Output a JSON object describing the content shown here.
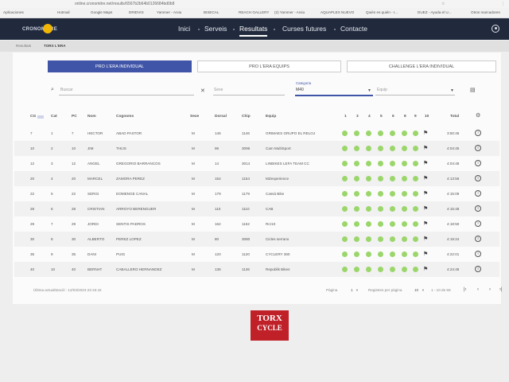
{
  "browser": {
    "url": "online.cronomitre.net/results/6567b2b64b0126684bd0b8",
    "bookmarks": [
      "Aplicaciones",
      "Hotmail",
      "Google Maps",
      "DRIDVIS",
      "Yammer - Arxiu",
      "BISECAL",
      "REACH GALLERY",
      "(2) Yammer - Arxiu",
      "AQUAPLEX NUEVO",
      "Quién es quién - I...",
      "DUEZ - Ayuda el U...",
      "Otros marcadores"
    ]
  },
  "nav": {
    "logo": "CRONOMITRE",
    "links": [
      "Inici",
      "Serveis",
      "Resultats",
      "Curses futures",
      "Contacte"
    ]
  },
  "breadcrumb": {
    "first": "Resultats",
    "second": "TORX L'ERA"
  },
  "tabs": [
    "PRO L'ERA INDIVIDUAL",
    "PRO L'ERA EQUIPS",
    "CHALLENGE L'ERA INDIVIDUAL"
  ],
  "filters": {
    "search_placeholder": "Buscar",
    "sexe_placeholder": "Sexe",
    "categoria_label": "Categoria",
    "categoria_value": "M40",
    "equip_placeholder": "Equip"
  },
  "table": {
    "headers": {
      "cg": "CG",
      "cat": "Cat",
      "pc": "PC",
      "nom": "Nom",
      "cognoms": "Cognoms",
      "sexe": "Sexe",
      "dorsal": "Dorsal",
      "chip": "Chip",
      "equip": "Equip",
      "laps": [
        "1",
        "3",
        "4",
        "5",
        "6",
        "8",
        "9",
        "10"
      ],
      "total": "Total"
    },
    "rows": [
      {
        "cg": "7",
        "cat": "1",
        "pc": "7",
        "nom": "HECTOR",
        "cognoms": "ABAD PASTOR",
        "sexe": "M",
        "dorsal": "146",
        "chip": "1146",
        "equip": "GRIMAES GRUPO EL RELOJ",
        "total": "3:50:46",
        "laps_done": 7,
        "flag": true
      },
      {
        "cg": "10",
        "cat": "2",
        "pc": "10",
        "nom": "JIM",
        "cognoms": "THIJS",
        "sexe": "M",
        "dorsal": "96",
        "chip": "3096",
        "equip": "Cam MultiSport",
        "total": "4:04:45",
        "laps_done": 7,
        "flag": true
      },
      {
        "cg": "12",
        "cat": "3",
        "pc": "12",
        "nom": "ANGEL",
        "cognoms": "GREGORIO BARRANCOS",
        "sexe": "M",
        "dorsal": "14",
        "chip": "3014",
        "equip": "LINBIKES LEFA TEAM CC",
        "total": "4:04:48",
        "laps_done": 7,
        "flag": true
      },
      {
        "cg": "20",
        "cat": "4",
        "pc": "20",
        "nom": "MARCEL",
        "cognoms": "ZAMORA PEREZ",
        "sexe": "M",
        "dorsal": "154",
        "chip": "1154",
        "equip": "MZexperience",
        "total": "4:13:56",
        "laps_done": 7,
        "flag": true
      },
      {
        "cg": "22",
        "cat": "5",
        "pc": "22",
        "nom": "SERGI",
        "cognoms": "DOMENGE CANAL",
        "sexe": "M",
        "dorsal": "179",
        "chip": "1179",
        "equip": "Cassà Bike",
        "total": "4:15:09",
        "laps_done": 7,
        "flag": true
      },
      {
        "cg": "28",
        "cat": "6",
        "pc": "28",
        "nom": "CRISTIAN",
        "cognoms": "ARROYO BERENGUER",
        "sexe": "M",
        "dorsal": "110",
        "chip": "1110",
        "equip": "CAB",
        "total": "4:15:48",
        "laps_done": 7,
        "flag": true
      },
      {
        "cg": "29",
        "cat": "7",
        "pc": "29",
        "nom": "JORDI",
        "cognoms": "SENTIS PADROS",
        "sexe": "M",
        "dorsal": "162",
        "chip": "1162",
        "equip": "Rcr10",
        "total": "4:18:50",
        "laps_done": 7,
        "flag": true
      },
      {
        "cg": "30",
        "cat": "8",
        "pc": "30",
        "nom": "ALBERTO",
        "cognoms": "PEREZ LOPEZ",
        "sexe": "M",
        "dorsal": "80",
        "chip": "3080",
        "equip": "Cicles serrano",
        "total": "4:19:24",
        "laps_done": 7,
        "flag": true
      },
      {
        "cg": "35",
        "cat": "9",
        "pc": "35",
        "nom": "DANI",
        "cognoms": "PUIG",
        "sexe": "M",
        "dorsal": "120",
        "chip": "1120",
        "equip": "CYCLERY 360",
        "total": "4:22:01",
        "laps_done": 7,
        "flag": true
      },
      {
        "cg": "40",
        "cat": "10",
        "pc": "40",
        "nom": "BERNAT",
        "cognoms": "CABALLERO HERNANDEZ",
        "sexe": "M",
        "dorsal": "136",
        "chip": "1136",
        "equip": "Republik Bikes",
        "total": "4:24:48",
        "laps_done": 7,
        "flag": true
      }
    ]
  },
  "footer": {
    "updated": "Última actualització : 12/03/2023 22:15:42",
    "page_label": "Pàgina",
    "page_value": "1",
    "per_page_label": "Registres per pàgina",
    "per_page_value": "10",
    "range": "1 - 10 de 59"
  },
  "sponsor": {
    "line1": "TORX",
    "line2": "CYCLE"
  },
  "colors": {
    "nav": "#212a3d",
    "accent": "#4155a8",
    "lap_dot": "#9bd66b",
    "sponsor": "#c02028"
  }
}
